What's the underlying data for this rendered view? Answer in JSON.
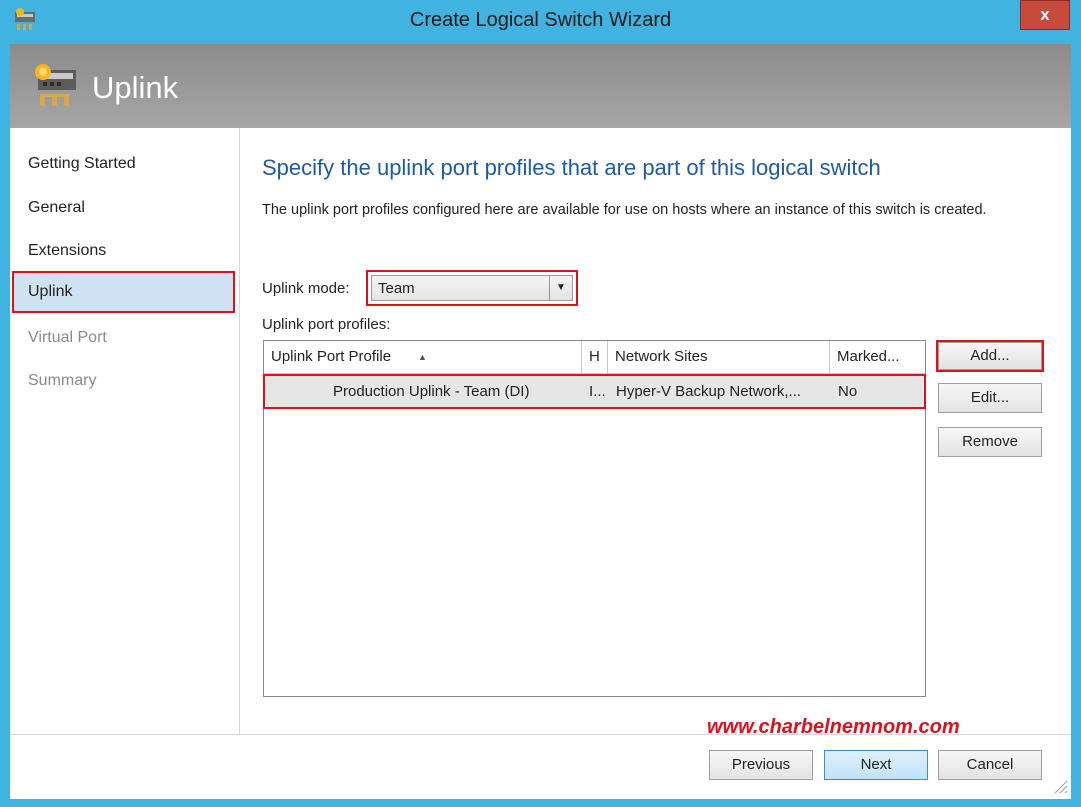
{
  "window": {
    "title": "Create Logical Switch Wizard",
    "close_label": "x"
  },
  "header": {
    "title": "Uplink"
  },
  "nav": {
    "items": [
      {
        "label": "Getting Started",
        "state": "done"
      },
      {
        "label": "General",
        "state": "done"
      },
      {
        "label": "Extensions",
        "state": "done"
      },
      {
        "label": "Uplink",
        "state": "selected"
      },
      {
        "label": "Virtual Port",
        "state": "disabled"
      },
      {
        "label": "Summary",
        "state": "disabled"
      }
    ]
  },
  "content": {
    "title": "Specify the uplink port profiles that are part of this logical switch",
    "description": "The uplink port profiles configured here are available for use on hosts where an instance of this switch is created.",
    "uplink_mode_label": "Uplink mode:",
    "uplink_mode_value": "Team",
    "profiles_label": "Uplink port profiles:"
  },
  "grid": {
    "columns": [
      "Uplink Port Profile",
      "H",
      "Network Sites",
      "Marked..."
    ],
    "rows": [
      {
        "profile": "Production Uplink - Team (DI)",
        "h": "I...",
        "network_sites": "Hyper-V Backup Network,...",
        "marked": "No"
      }
    ]
  },
  "side_buttons": {
    "add": "Add...",
    "edit": "Edit...",
    "remove": "Remove"
  },
  "footer": {
    "watermark": "www.charbelnemnom.com",
    "previous": "Previous",
    "next": "Next",
    "cancel": "Cancel"
  },
  "colors": {
    "frame": "#40b3e0",
    "highlight": "#e0111b",
    "title_blue": "#1e5aa8",
    "selected_bg": "#cfe3f5"
  }
}
